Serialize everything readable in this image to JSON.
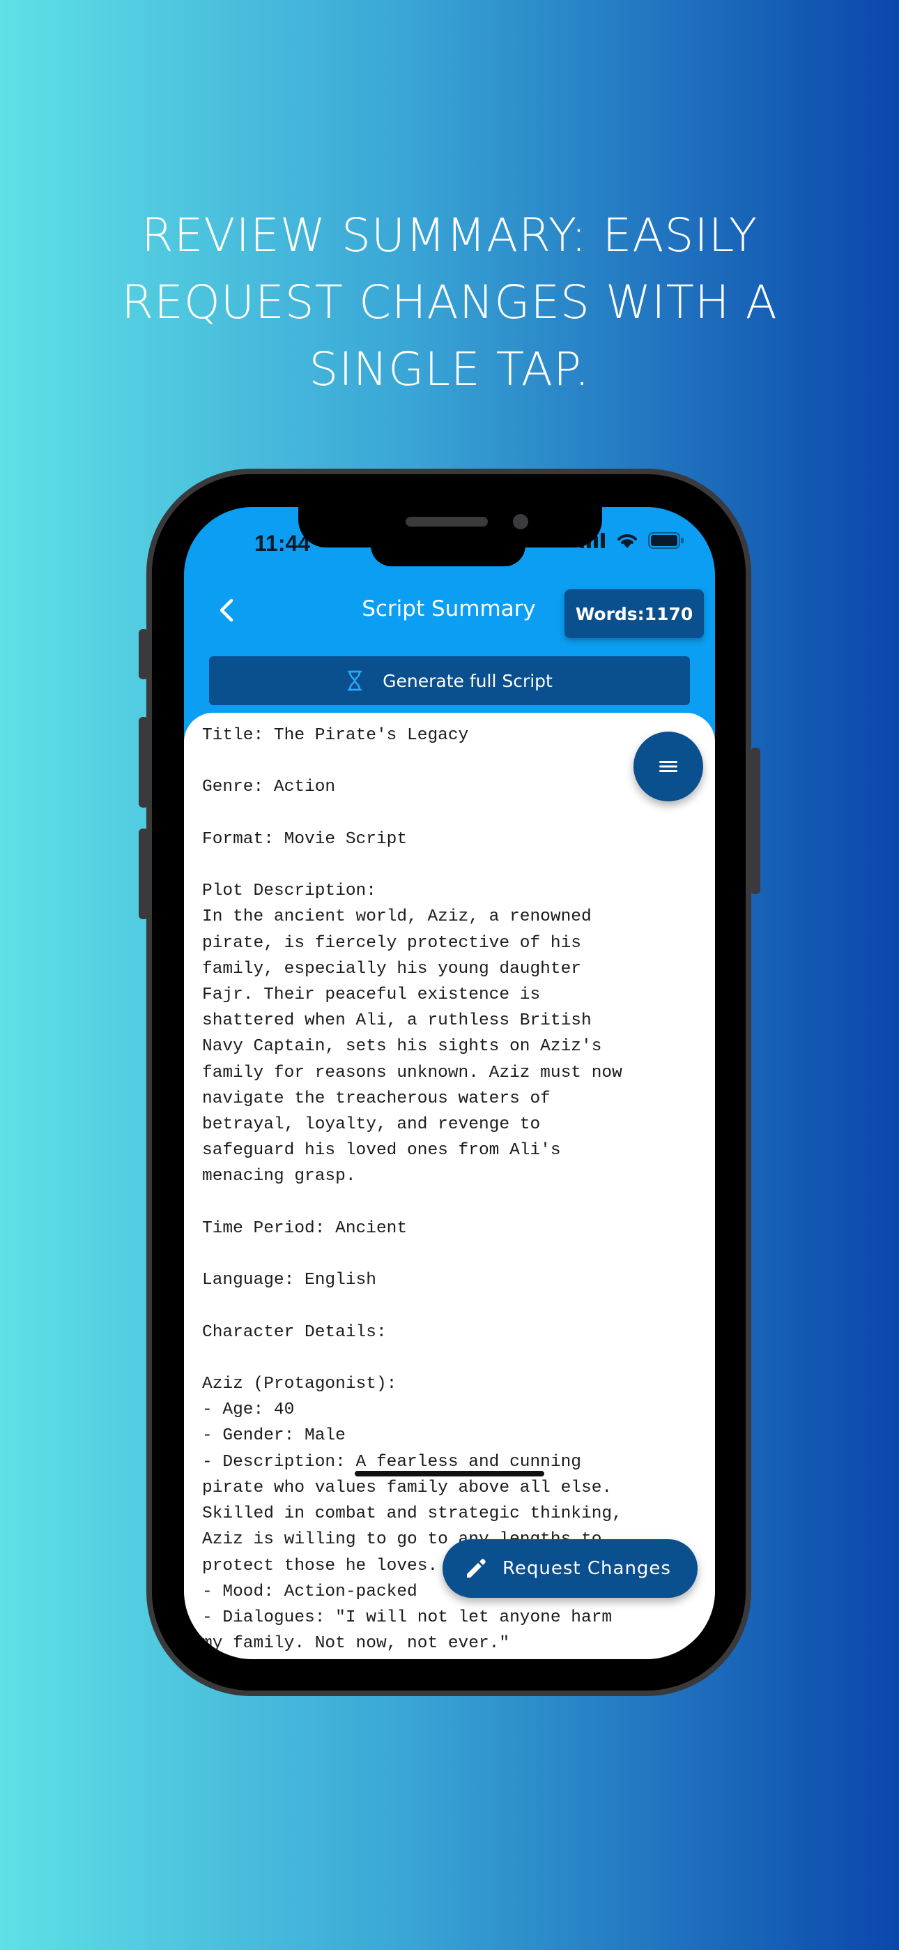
{
  "promo": {
    "headline_line1": "REVIEW SUMMARY: EASILY",
    "headline_line2": "REQUEST CHANGES WITH A",
    "headline_line3": "SINGLE TAP."
  },
  "status_bar": {
    "time": "11:44",
    "icons": [
      "signal-icon",
      "wifi-icon",
      "battery-icon"
    ]
  },
  "app_bar": {
    "back_icon": "chevron-left-icon",
    "title": "Script Summary",
    "words_badge": "Words:1170"
  },
  "generate_button": {
    "icon": "hourglass-icon",
    "label": "Generate full Script"
  },
  "script": {
    "text": "Title: The Pirate's Legacy\n\nGenre: Action\n\nFormat: Movie Script\n\nPlot Description:\nIn the ancient world, Aziz, a renowned\npirate, is fiercely protective of his\nfamily, especially his young daughter\nFajr. Their peaceful existence is\nshattered when Ali, a ruthless British\nNavy Captain, sets his sights on Aziz's\nfamily for reasons unknown. Aziz must now\nnavigate the treacherous waters of\nbetrayal, loyalty, and revenge to\nsafeguard his loved ones from Ali's\nmenacing grasp.\n\nTime Period: Ancient\n\nLanguage: English\n\nCharacter Details:\n\nAziz (Protagonist):\n- Age: 40\n- Gender: Male\n- Description: A fearless and cunning\npirate who values family above all else.\nSkilled in combat and strategic thinking,\nAziz is willing to go to any lengths to\nprotect those he loves.\n- Mood: Action-packed\n- Dialogues: \"I will not let anyone harm\nmy family. Not now, not ever.\""
  },
  "menu_fab": {
    "icon": "menu-icon"
  },
  "request_button": {
    "icon": "pencil-icon",
    "label": "Request Changes"
  },
  "colors": {
    "app_bar": "#0b9ef2",
    "primary_dark": "#0a4f8e",
    "bg_left": "#5fe0e6",
    "bg_right": "#0a47ab"
  }
}
